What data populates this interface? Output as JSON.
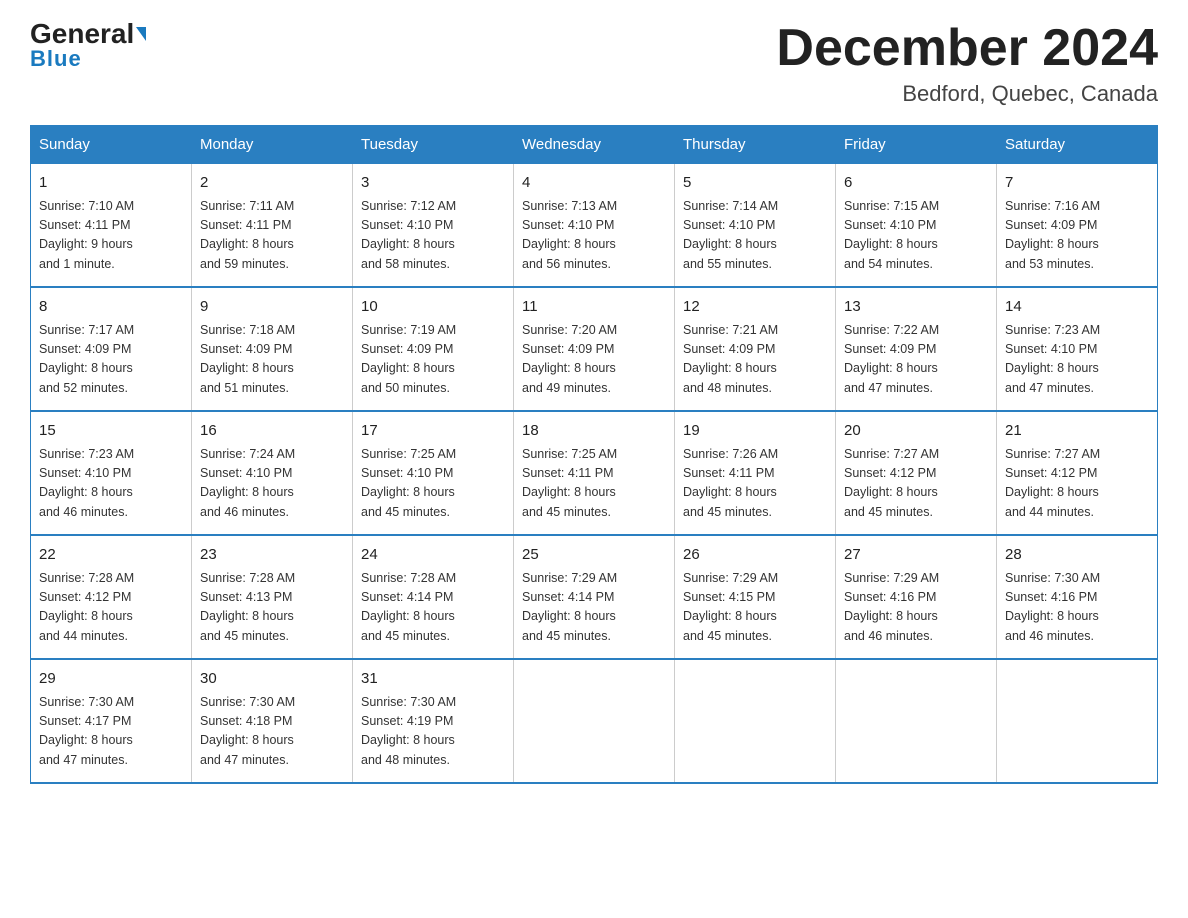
{
  "header": {
    "logo_line1": "General",
    "logo_line2": "Blue",
    "main_title": "December 2024",
    "subtitle": "Bedford, Quebec, Canada"
  },
  "days_of_week": [
    "Sunday",
    "Monday",
    "Tuesday",
    "Wednesday",
    "Thursday",
    "Friday",
    "Saturday"
  ],
  "weeks": [
    [
      {
        "day": "1",
        "info": "Sunrise: 7:10 AM\nSunset: 4:11 PM\nDaylight: 9 hours\nand 1 minute."
      },
      {
        "day": "2",
        "info": "Sunrise: 7:11 AM\nSunset: 4:11 PM\nDaylight: 8 hours\nand 59 minutes."
      },
      {
        "day": "3",
        "info": "Sunrise: 7:12 AM\nSunset: 4:10 PM\nDaylight: 8 hours\nand 58 minutes."
      },
      {
        "day": "4",
        "info": "Sunrise: 7:13 AM\nSunset: 4:10 PM\nDaylight: 8 hours\nand 56 minutes."
      },
      {
        "day": "5",
        "info": "Sunrise: 7:14 AM\nSunset: 4:10 PM\nDaylight: 8 hours\nand 55 minutes."
      },
      {
        "day": "6",
        "info": "Sunrise: 7:15 AM\nSunset: 4:10 PM\nDaylight: 8 hours\nand 54 minutes."
      },
      {
        "day": "7",
        "info": "Sunrise: 7:16 AM\nSunset: 4:09 PM\nDaylight: 8 hours\nand 53 minutes."
      }
    ],
    [
      {
        "day": "8",
        "info": "Sunrise: 7:17 AM\nSunset: 4:09 PM\nDaylight: 8 hours\nand 52 minutes."
      },
      {
        "day": "9",
        "info": "Sunrise: 7:18 AM\nSunset: 4:09 PM\nDaylight: 8 hours\nand 51 minutes."
      },
      {
        "day": "10",
        "info": "Sunrise: 7:19 AM\nSunset: 4:09 PM\nDaylight: 8 hours\nand 50 minutes."
      },
      {
        "day": "11",
        "info": "Sunrise: 7:20 AM\nSunset: 4:09 PM\nDaylight: 8 hours\nand 49 minutes."
      },
      {
        "day": "12",
        "info": "Sunrise: 7:21 AM\nSunset: 4:09 PM\nDaylight: 8 hours\nand 48 minutes."
      },
      {
        "day": "13",
        "info": "Sunrise: 7:22 AM\nSunset: 4:09 PM\nDaylight: 8 hours\nand 47 minutes."
      },
      {
        "day": "14",
        "info": "Sunrise: 7:23 AM\nSunset: 4:10 PM\nDaylight: 8 hours\nand 47 minutes."
      }
    ],
    [
      {
        "day": "15",
        "info": "Sunrise: 7:23 AM\nSunset: 4:10 PM\nDaylight: 8 hours\nand 46 minutes."
      },
      {
        "day": "16",
        "info": "Sunrise: 7:24 AM\nSunset: 4:10 PM\nDaylight: 8 hours\nand 46 minutes."
      },
      {
        "day": "17",
        "info": "Sunrise: 7:25 AM\nSunset: 4:10 PM\nDaylight: 8 hours\nand 45 minutes."
      },
      {
        "day": "18",
        "info": "Sunrise: 7:25 AM\nSunset: 4:11 PM\nDaylight: 8 hours\nand 45 minutes."
      },
      {
        "day": "19",
        "info": "Sunrise: 7:26 AM\nSunset: 4:11 PM\nDaylight: 8 hours\nand 45 minutes."
      },
      {
        "day": "20",
        "info": "Sunrise: 7:27 AM\nSunset: 4:12 PM\nDaylight: 8 hours\nand 45 minutes."
      },
      {
        "day": "21",
        "info": "Sunrise: 7:27 AM\nSunset: 4:12 PM\nDaylight: 8 hours\nand 44 minutes."
      }
    ],
    [
      {
        "day": "22",
        "info": "Sunrise: 7:28 AM\nSunset: 4:12 PM\nDaylight: 8 hours\nand 44 minutes."
      },
      {
        "day": "23",
        "info": "Sunrise: 7:28 AM\nSunset: 4:13 PM\nDaylight: 8 hours\nand 45 minutes."
      },
      {
        "day": "24",
        "info": "Sunrise: 7:28 AM\nSunset: 4:14 PM\nDaylight: 8 hours\nand 45 minutes."
      },
      {
        "day": "25",
        "info": "Sunrise: 7:29 AM\nSunset: 4:14 PM\nDaylight: 8 hours\nand 45 minutes."
      },
      {
        "day": "26",
        "info": "Sunrise: 7:29 AM\nSunset: 4:15 PM\nDaylight: 8 hours\nand 45 minutes."
      },
      {
        "day": "27",
        "info": "Sunrise: 7:29 AM\nSunset: 4:16 PM\nDaylight: 8 hours\nand 46 minutes."
      },
      {
        "day": "28",
        "info": "Sunrise: 7:30 AM\nSunset: 4:16 PM\nDaylight: 8 hours\nand 46 minutes."
      }
    ],
    [
      {
        "day": "29",
        "info": "Sunrise: 7:30 AM\nSunset: 4:17 PM\nDaylight: 8 hours\nand 47 minutes."
      },
      {
        "day": "30",
        "info": "Sunrise: 7:30 AM\nSunset: 4:18 PM\nDaylight: 8 hours\nand 47 minutes."
      },
      {
        "day": "31",
        "info": "Sunrise: 7:30 AM\nSunset: 4:19 PM\nDaylight: 8 hours\nand 48 minutes."
      },
      {
        "day": "",
        "info": ""
      },
      {
        "day": "",
        "info": ""
      },
      {
        "day": "",
        "info": ""
      },
      {
        "day": "",
        "info": ""
      }
    ]
  ]
}
